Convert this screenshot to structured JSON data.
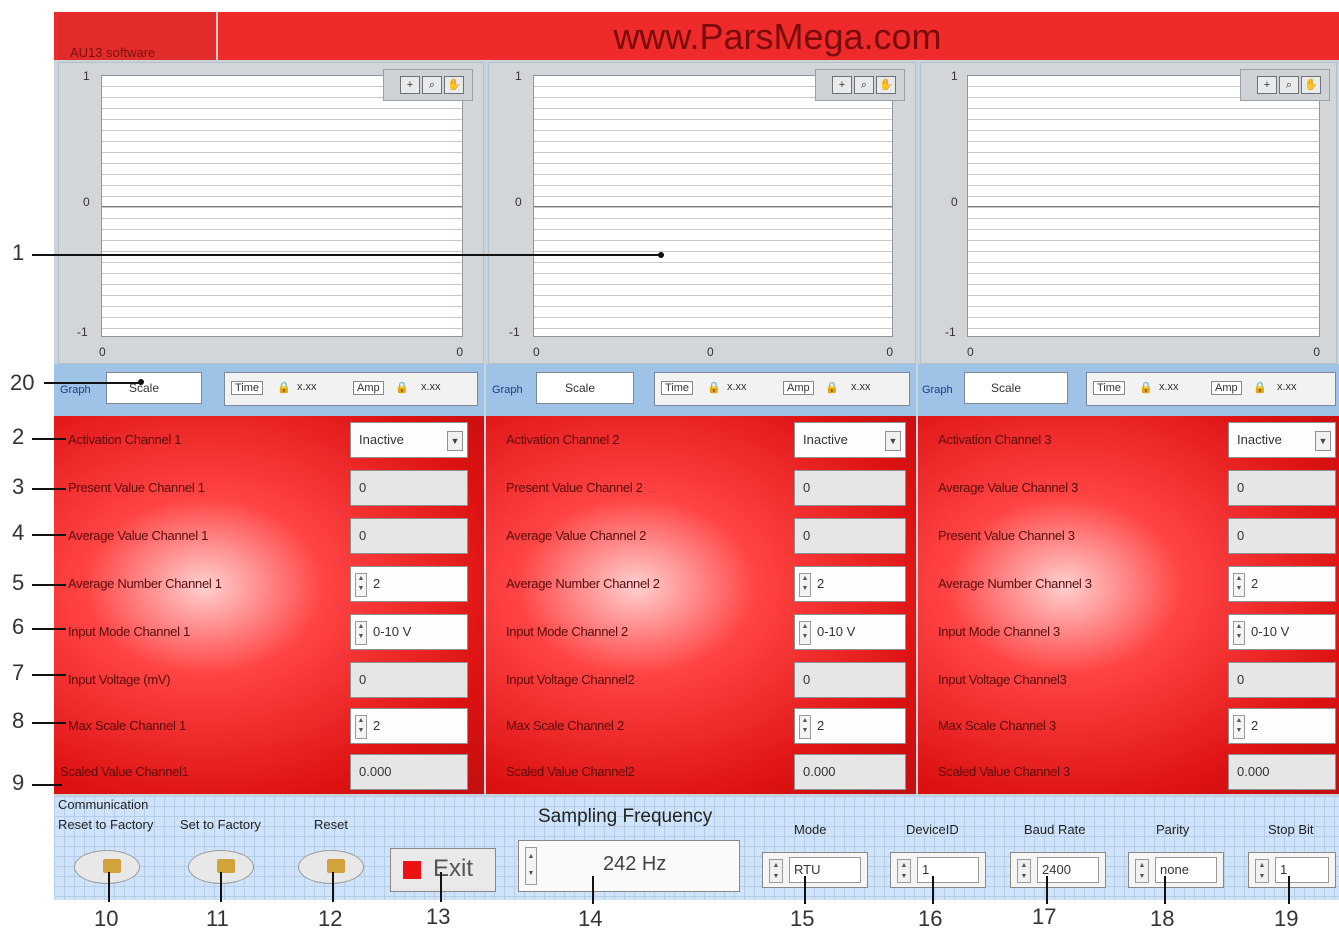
{
  "app": {
    "software_label": "AU13 software",
    "site_title": "www.ParsMega.com"
  },
  "graphs": [
    {
      "y_top": "1",
      "y_mid": "0",
      "y_bot": "-1",
      "x_left": "0",
      "x_mid": "",
      "x_right": "0"
    },
    {
      "y_top": "1",
      "y_mid": "0",
      "y_bot": "-1",
      "x_left": "0",
      "x_mid": "0",
      "x_right": "0"
    },
    {
      "y_top": "1",
      "y_mid": "0",
      "y_bot": "-1",
      "x_left": "0",
      "x_mid": "",
      "x_right": "0"
    }
  ],
  "graph_controls": [
    {
      "graph_label": "Graph",
      "scale_value": "Scale",
      "time_label": "Time",
      "amp_label": "Amp"
    },
    {
      "graph_label": "Graph",
      "scale_value": "Scale",
      "time_label": "Time",
      "amp_label": "Amp"
    },
    {
      "graph_label": "Graph",
      "scale_value": "Scale",
      "time_label": "Time",
      "amp_label": "Amp"
    }
  ],
  "channels": [
    {
      "activation_label": "Activation Channel 1",
      "activation_value": "Inactive",
      "present_label": "Present Value Channel 1",
      "present_value": "0",
      "average_label": "Average Value Channel 1",
      "average_value": "0",
      "avg_number_label": "Average Number Channel 1",
      "avg_number_value": "2",
      "input_mode_label": "Input Mode Channel 1",
      "input_mode_value": "0-10 V",
      "input_voltage_label": "Input Voltage (mV)",
      "input_voltage_value": "0",
      "max_scale_label": "Max Scale Channel 1",
      "max_scale_value": "2",
      "scaled_value_label": "Scaled Value Channel1",
      "scaled_value": "0.000"
    },
    {
      "activation_label": "Activation Channel 2",
      "activation_value": "Inactive",
      "present_label": "Present Value Channel 2",
      "present_value": "0",
      "average_label": "Average Value Channel 2",
      "average_value": "0",
      "avg_number_label": "Average Number Channel 2",
      "avg_number_value": "2",
      "input_mode_label": "Input Mode Channel 2",
      "input_mode_value": "0-10 V",
      "input_voltage_label": "Input Voltage Channel2",
      "input_voltage_value": "0",
      "max_scale_label": "Max Scale Channel 2",
      "max_scale_value": "2",
      "scaled_value_label": "Scaled Value Channel2",
      "scaled_value": "0.000"
    },
    {
      "activation_label": "Activation Channel 3",
      "activation_value": "Inactive",
      "present_label": "Average Value Channel 3",
      "present_value": "0",
      "average_label": "Present Value Channel 3",
      "average_value": "0",
      "avg_number_label": "Average Number Channel 3",
      "avg_number_value": "2",
      "input_mode_label": "Input Mode Channel 3",
      "input_mode_value": "0-10 V",
      "input_voltage_label": "Input Voltage Channel3",
      "input_voltage_value": "0",
      "max_scale_label": "Max Scale Channel 3",
      "max_scale_value": "2",
      "scaled_value_label": "Scaled Value Channel 3",
      "scaled_value": "0.000"
    }
  ],
  "bottom": {
    "communication_label": "Communication",
    "reset_factory_label": "Reset to Factory",
    "set_factory_label": "Set to Factory",
    "reset_label": "Reset",
    "exit_label": "Exit",
    "sampling_label": "Sampling Frequency",
    "sampling_value": "242 Hz",
    "mode_label": "Mode",
    "mode_value": "RTU",
    "device_label": "DeviceID",
    "device_value": "1",
    "baud_label": "Baud Rate",
    "baud_value": "2400",
    "parity_label": "Parity",
    "parity_value": "none",
    "stop_label": "Stop Bit",
    "stop_value": "1"
  },
  "callouts": {
    "n1": "1",
    "n2": "2",
    "n3": "3",
    "n4": "4",
    "n5": "5",
    "n6": "6",
    "n7": "7",
    "n8": "8",
    "n9": "9",
    "n10": "10",
    "n11": "11",
    "n12": "12",
    "n13": "13",
    "n14": "14",
    "n15": "15",
    "n16": "16",
    "n17": "17",
    "n18": "18",
    "n19": "19",
    "n20": "20"
  }
}
